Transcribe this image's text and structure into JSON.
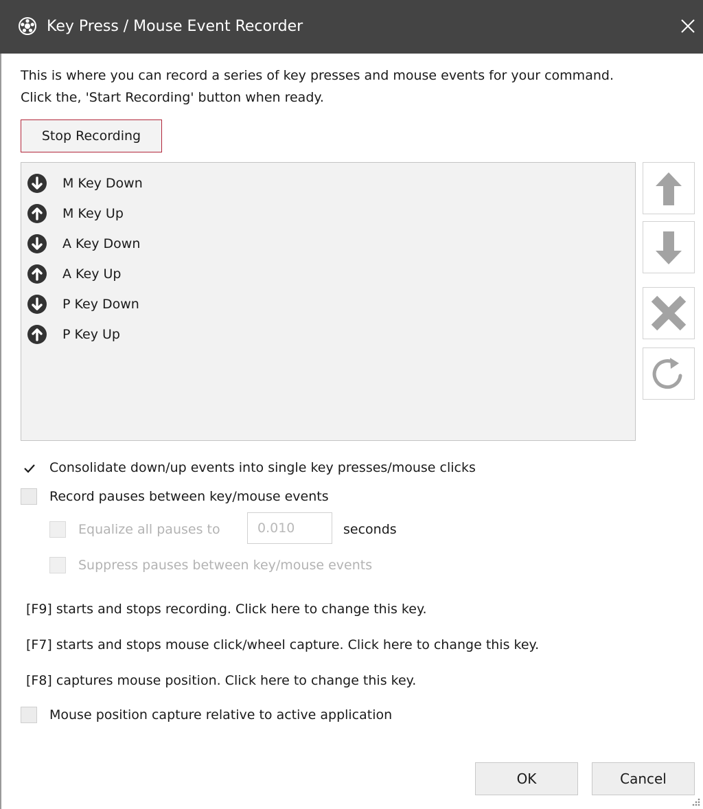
{
  "window": {
    "title": "Key Press / Mouse Event Recorder",
    "app_icon": "gear-film-icon",
    "close_icon": "close-icon"
  },
  "intro": {
    "line1": "This is where you can record a series of key presses and mouse events for your command.",
    "line2": "Click the, 'Start Recording' button when ready."
  },
  "record_button": {
    "label": "Stop Recording",
    "border_color": "#b2263a"
  },
  "events": [
    {
      "label": "M Key Down",
      "icon": "arrow-down-circle-icon"
    },
    {
      "label": "M Key Up",
      "icon": "arrow-up-circle-icon"
    },
    {
      "label": "A Key Down",
      "icon": "arrow-down-circle-icon"
    },
    {
      "label": "A Key Up",
      "icon": "arrow-up-circle-icon"
    },
    {
      "label": "P Key Down",
      "icon": "arrow-down-circle-icon"
    },
    {
      "label": "P Key Up",
      "icon": "arrow-up-circle-icon"
    }
  ],
  "side_buttons": [
    {
      "name": "move-up-button",
      "icon": "arrow-up-icon"
    },
    {
      "name": "move-down-button",
      "icon": "arrow-down-icon"
    },
    {
      "name": "delete-button",
      "icon": "x-icon"
    },
    {
      "name": "refresh-button",
      "icon": "refresh-icon"
    }
  ],
  "options": {
    "consolidate": {
      "label": "Consolidate down/up events into single key presses/mouse clicks",
      "checked": true
    },
    "record_pauses": {
      "label": "Record pauses between key/mouse events",
      "checked": false
    },
    "equalize_pauses": {
      "label": "Equalize all pauses to",
      "checked": false,
      "disabled": true,
      "value": "0.010",
      "unit": "seconds"
    },
    "suppress_pauses": {
      "label": "Suppress pauses between key/mouse events",
      "checked": false,
      "disabled": true
    },
    "relative_capture": {
      "label": "Mouse position capture relative to active application",
      "checked": false
    }
  },
  "hotkeys": {
    "recording": "[F9] starts and stops recording.  Click here to change this key.",
    "mouse_capture": "[F7] starts and stops mouse click/wheel capture.  Click here to change this key.",
    "mouse_position": "[F8] captures mouse position.  Click here to change this key."
  },
  "buttons": {
    "ok": "OK",
    "cancel": "Cancel"
  },
  "colors": {
    "titlebar": "#444444",
    "list_background": "#f2f2f2",
    "disabled_text": "#b3b3b3",
    "icon_gray": "#9a9a9a"
  }
}
